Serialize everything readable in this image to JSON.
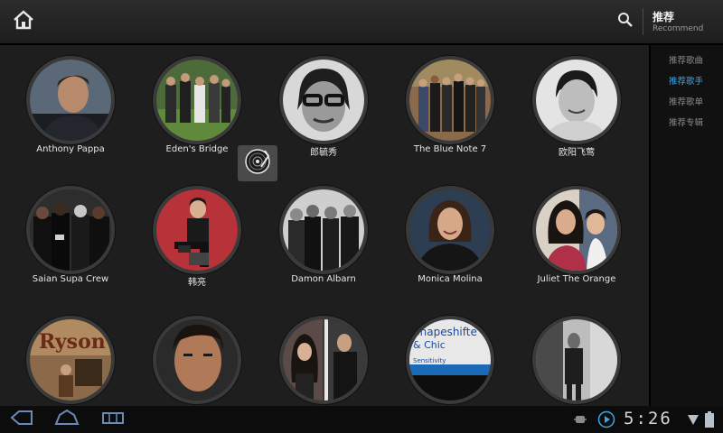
{
  "header": {
    "title": "推荐",
    "subtitle": "Recommend"
  },
  "side_menu": {
    "items": [
      {
        "label": "推荐歌曲",
        "active": false
      },
      {
        "label": "推荐歌手",
        "active": true
      },
      {
        "label": "推荐歌单",
        "active": false
      },
      {
        "label": "推荐专辑",
        "active": false
      }
    ]
  },
  "artists": [
    {
      "name": "Anthony Pappa"
    },
    {
      "name": "Eden's Bridge"
    },
    {
      "name": "郎毓秀"
    },
    {
      "name": "The Blue Note 7"
    },
    {
      "name": "欧阳飞莺"
    },
    {
      "name": "Saian Supa Crew"
    },
    {
      "name": "韩亮"
    },
    {
      "name": "Damon Albarn"
    },
    {
      "name": "Monica Molina"
    },
    {
      "name": "Juliet The Orange"
    },
    {
      "name": ""
    },
    {
      "name": ""
    },
    {
      "name": ""
    },
    {
      "name": ""
    },
    {
      "name": ""
    }
  ],
  "thumbnail_text": {
    "album_text": "Ryson",
    "shapeshifters_line1": "Shapeshifte",
    "shapeshifters_line2": "& Chic",
    "shapeshifters_line3": "Sensitivity"
  },
  "status": {
    "time": "5:26"
  },
  "colors": {
    "accent": "#3aa8e8",
    "background": "#1e1e1e",
    "topbar": "#252525"
  }
}
